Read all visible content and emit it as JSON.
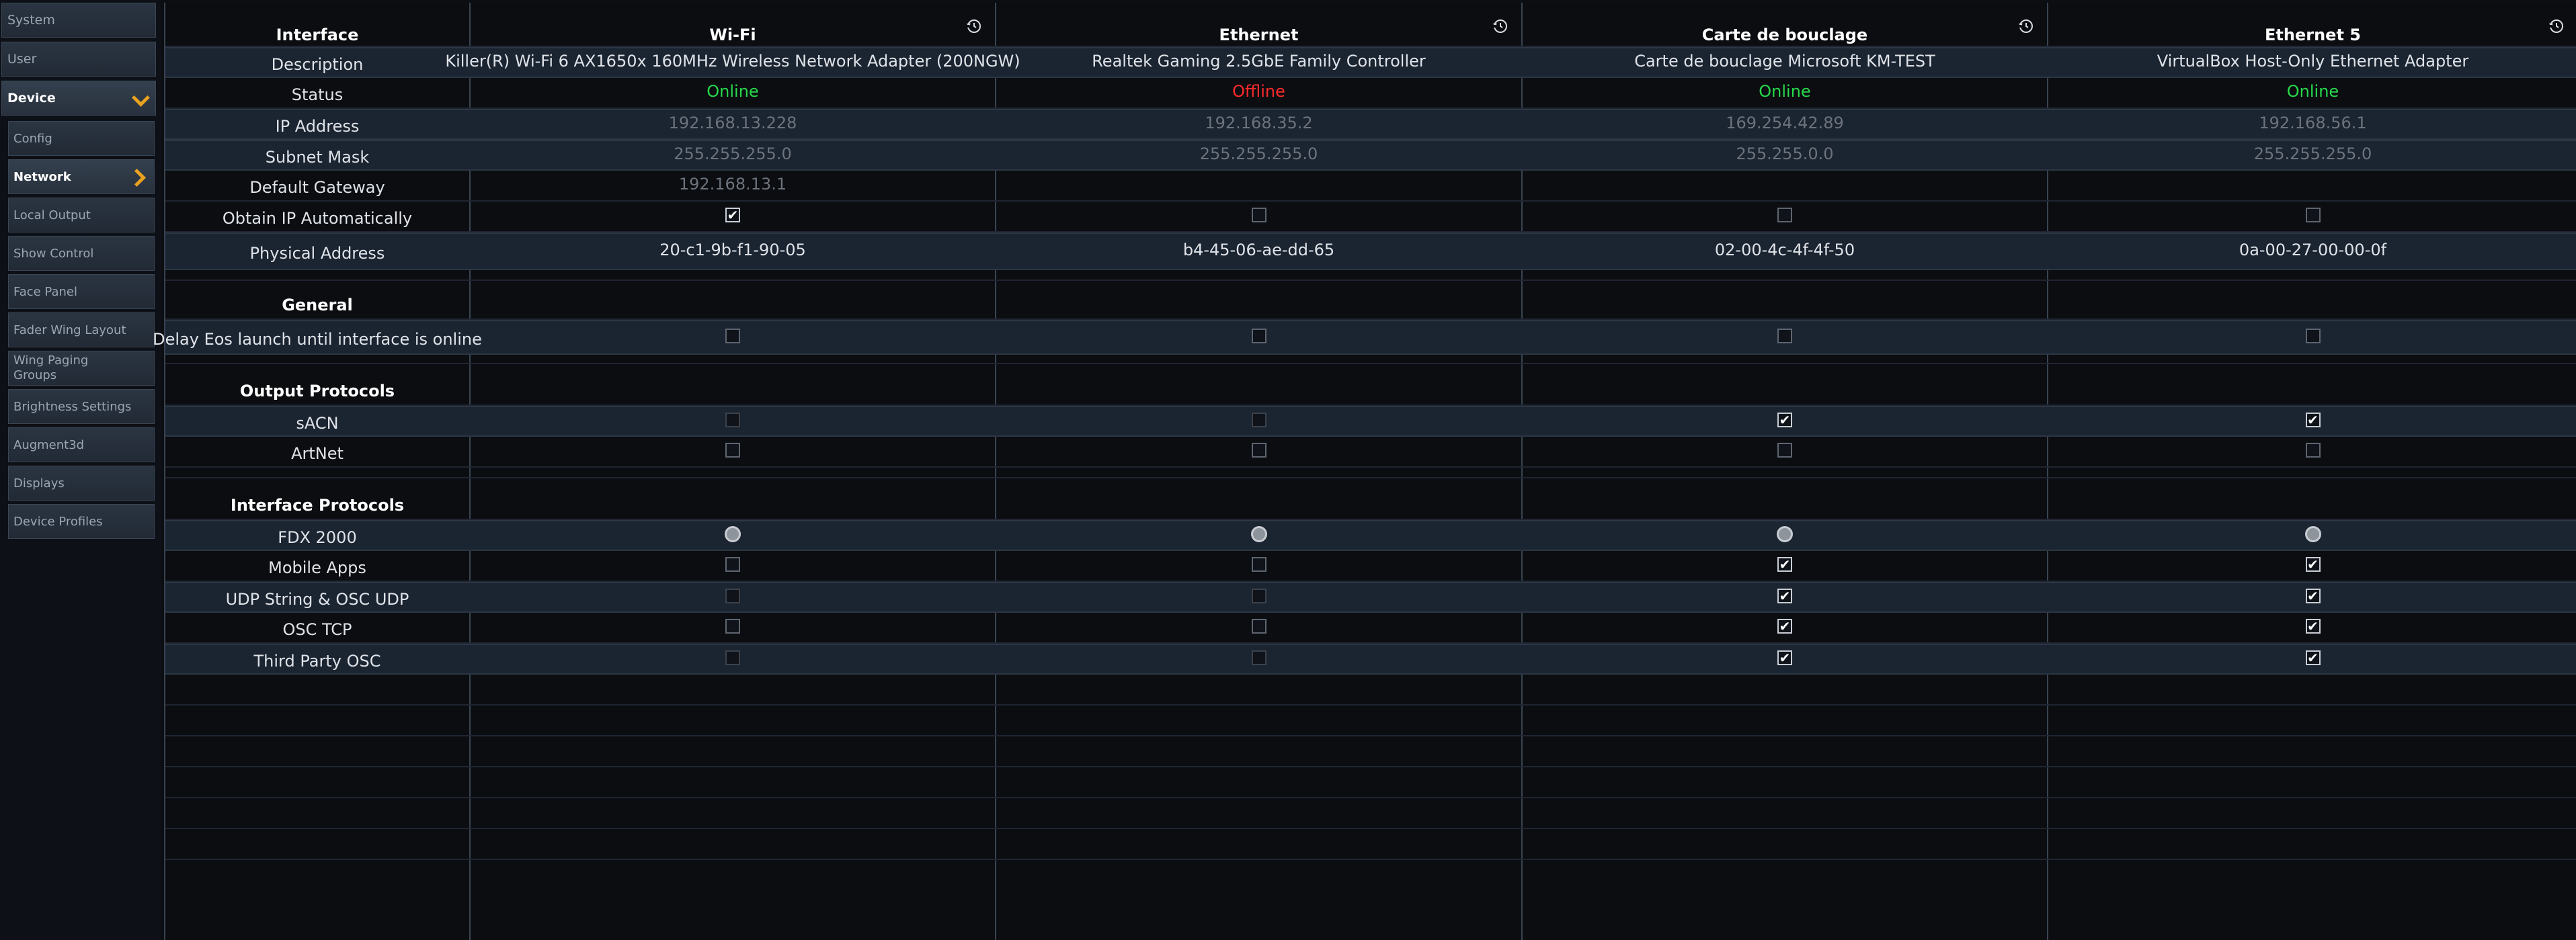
{
  "sidebar": {
    "top_items": [
      {
        "label": "System"
      },
      {
        "label": "User"
      },
      {
        "label": "Device"
      }
    ],
    "device_items": [
      {
        "label": "Config"
      },
      {
        "label": "Network"
      },
      {
        "label": "Local Output"
      },
      {
        "label": "Show Control"
      },
      {
        "label": "Face Panel"
      },
      {
        "label": "Fader Wing Layout"
      },
      {
        "label": "Wing Paging Groups"
      },
      {
        "label": "Brightness Settings"
      },
      {
        "label": "Augment3d"
      },
      {
        "label": "Displays"
      },
      {
        "label": "Device Profiles"
      }
    ]
  },
  "table": {
    "header_label": "Interface",
    "columns": [
      {
        "name": "Wi-Fi",
        "description": "Killer(R) Wi-Fi 6 AX1650x 160MHz Wireless Network Adapter (200NGW)",
        "status": "Online",
        "ip": "192.168.13.228",
        "mask": "255.255.255.0",
        "gateway": "192.168.13.1",
        "mac": "20-c1-9b-f1-90-05"
      },
      {
        "name": "Ethernet",
        "description": "Realtek Gaming 2.5GbE Family Controller",
        "status": "Offline",
        "ip": "192.168.35.2",
        "mask": "255.255.255.0",
        "gateway": "",
        "mac": "b4-45-06-ae-dd-65"
      },
      {
        "name": "Carte de bouclage",
        "description": "Carte de bouclage Microsoft KM-TEST",
        "status": "Online",
        "ip": "169.254.42.89",
        "mask": "255.255.0.0",
        "gateway": "",
        "mac": "02-00-4c-4f-4f-50"
      },
      {
        "name": "Ethernet 5",
        "description": "VirtualBox Host-Only Ethernet Adapter",
        "status": "Online",
        "ip": "192.168.56.1",
        "mask": "255.255.255.0",
        "gateway": "",
        "mac": "0a-00-27-00-00-0f"
      }
    ],
    "row_labels": {
      "description": "Description",
      "status": "Status",
      "ip": "IP Address",
      "mask": "Subnet Mask",
      "gateway": "Default Gateway",
      "obtain": "Obtain IP Automatically",
      "mac": "Physical Address",
      "general": "General",
      "delay": "Delay Eos launch until interface is online",
      "output_protocols": "Output Protocols",
      "sacn": "sACN",
      "artnet": "ArtNet",
      "interface_protocols": "Interface Protocols",
      "fdx": "FDX 2000",
      "mobile": "Mobile Apps",
      "udp": "UDP String & OSC UDP",
      "osctcp": "OSC TCP",
      "thirdparty": "Third Party OSC"
    },
    "checkbox_rows": {
      "obtain": [
        true,
        false,
        false,
        false
      ],
      "delay": [
        false,
        false,
        false,
        false
      ],
      "sacn": [
        false,
        false,
        true,
        true
      ],
      "artnet": [
        false,
        false,
        false,
        false
      ],
      "mobile": [
        false,
        false,
        true,
        true
      ],
      "udp": [
        false,
        false,
        true,
        true
      ],
      "osctcp": [
        false,
        false,
        true,
        true
      ],
      "thirdparty": [
        false,
        false,
        true,
        true
      ]
    },
    "check_glyph": "✔",
    "icons": {
      "reset": "reset-history-icon",
      "checkbox": "checkbox-icon",
      "radio": "radio-icon"
    },
    "colors": {
      "online": "#27d94b",
      "offline": "#ff2a2a",
      "accent": "#e9a21f"
    }
  }
}
